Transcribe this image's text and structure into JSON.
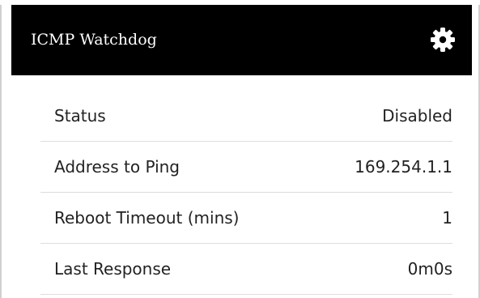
{
  "widget": {
    "title": "ICMP Watchdog",
    "settings_icon": "gear-icon",
    "colors": {
      "header_background": "#000000",
      "header_text": "#ffffff",
      "row_divider": "#dddddd"
    }
  },
  "rows": [
    {
      "label": "Status",
      "value": "Disabled"
    },
    {
      "label": "Address to Ping",
      "value": "169.254.1.1"
    },
    {
      "label": "Reboot Timeout (mins)",
      "value": "1"
    },
    {
      "label": "Last Response",
      "value": "0m0s"
    }
  ]
}
